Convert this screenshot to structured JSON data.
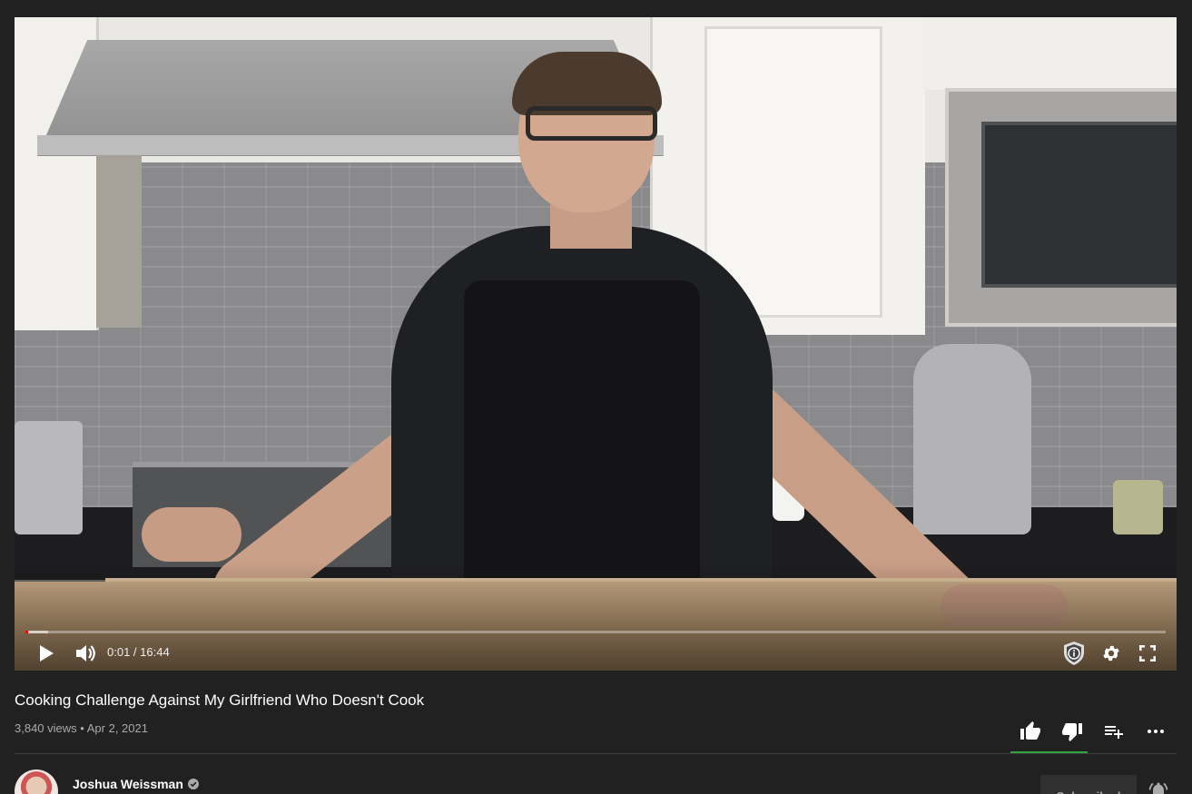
{
  "player": {
    "current_time": "0:01",
    "separator": " / ",
    "duration": "16:44",
    "progress_fraction": 0.001,
    "buffered_fraction": 0.02,
    "icons": {
      "play": "play-icon",
      "volume": "volume-icon",
      "extension": "shield-info-icon",
      "settings": "gear-icon",
      "fullscreen": "fullscreen-icon"
    }
  },
  "video": {
    "title": "Cooking Challenge Against My Girlfriend Who Doesn't Cook",
    "views": "3,840 views",
    "dot": "•",
    "date": "Apr 2, 2021"
  },
  "actions": {
    "icons": [
      "thumbs-up-icon",
      "thumbs-down-icon",
      "add-to-playlist-icon",
      "more-icon"
    ],
    "like_bar_color": "#2ba640"
  },
  "channel": {
    "name": "Joshua Weissman",
    "subscribe_label": "Subscribed"
  },
  "colors": {
    "background": "#212121",
    "progress": "#ff0000",
    "divider": "#3d3d3d"
  }
}
